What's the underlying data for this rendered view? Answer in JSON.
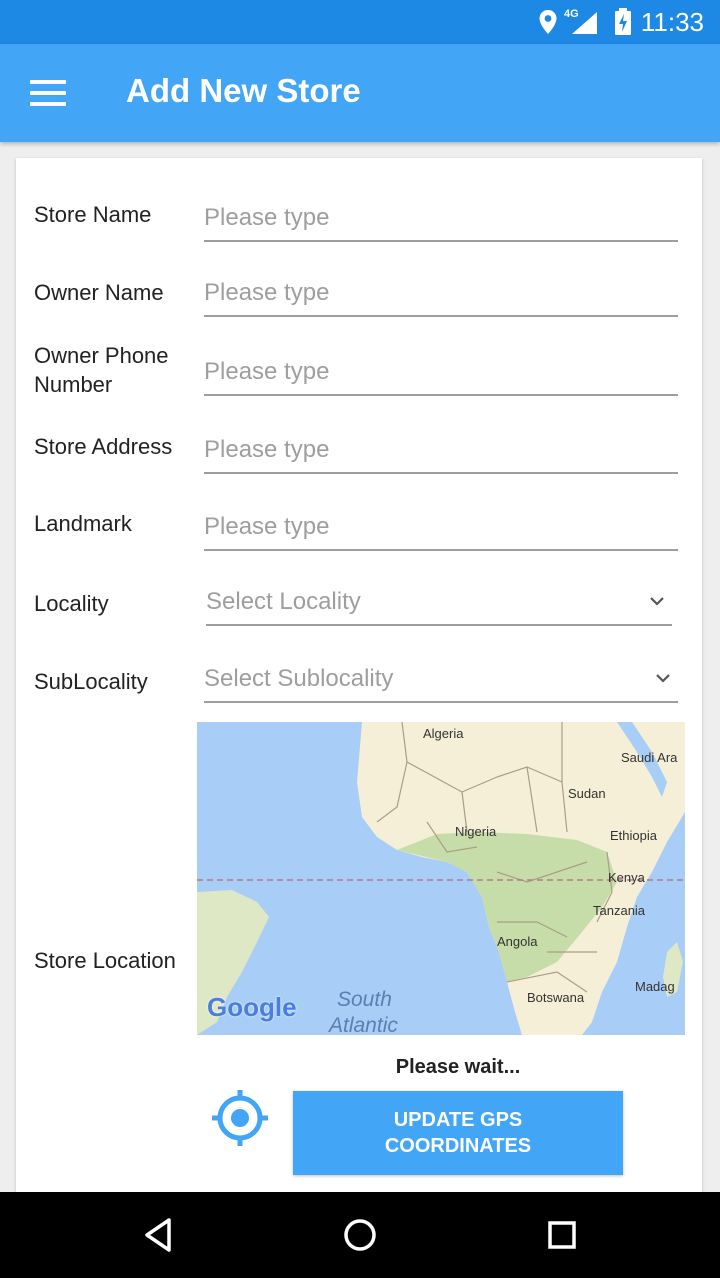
{
  "status_bar": {
    "network": "4G",
    "time": "11:33",
    "icons": [
      "location-icon",
      "signal-icon",
      "battery-charging-icon"
    ]
  },
  "app_bar": {
    "title": "Add New Store",
    "menu_icon": "menu-icon"
  },
  "form": {
    "store_name": {
      "label": "Store Name",
      "placeholder": "Please type"
    },
    "owner_name": {
      "label": "Owner Name",
      "placeholder": "Please type"
    },
    "owner_phone": {
      "label": "Owner Phone Number",
      "placeholder": "Please type"
    },
    "store_address": {
      "label": "Store Address",
      "placeholder": "Please type"
    },
    "landmark": {
      "label": "Landmark",
      "placeholder": "Please type"
    },
    "locality": {
      "label": "Locality",
      "selected": "Select Locality"
    },
    "sublocality": {
      "label": "SubLocality",
      "selected": "Select Sublocality"
    },
    "store_location": {
      "label": "Store Location",
      "map": {
        "labels": [
          "Algeria",
          "Saudi Ara",
          "Sudan",
          "Nigeria",
          "Ethiopia",
          "Kenya",
          "Tanzania",
          "Angola",
          "Botswana",
          "Madag",
          "South",
          "Atlantic"
        ],
        "logo": "Google"
      }
    },
    "wait_text": "Please wait...",
    "gps_button": {
      "line1": "UPDATE GPS",
      "line2": "COORDINATES"
    }
  },
  "colors": {
    "status_bar": "#1e88e5",
    "app_bar": "#42a5f5",
    "button": "#42a5f5",
    "map_ocean": "#a8cdf7",
    "map_land": "#f4efd6"
  },
  "nav_bar": {
    "icons": [
      "back-icon",
      "home-icon",
      "recents-icon"
    ]
  }
}
